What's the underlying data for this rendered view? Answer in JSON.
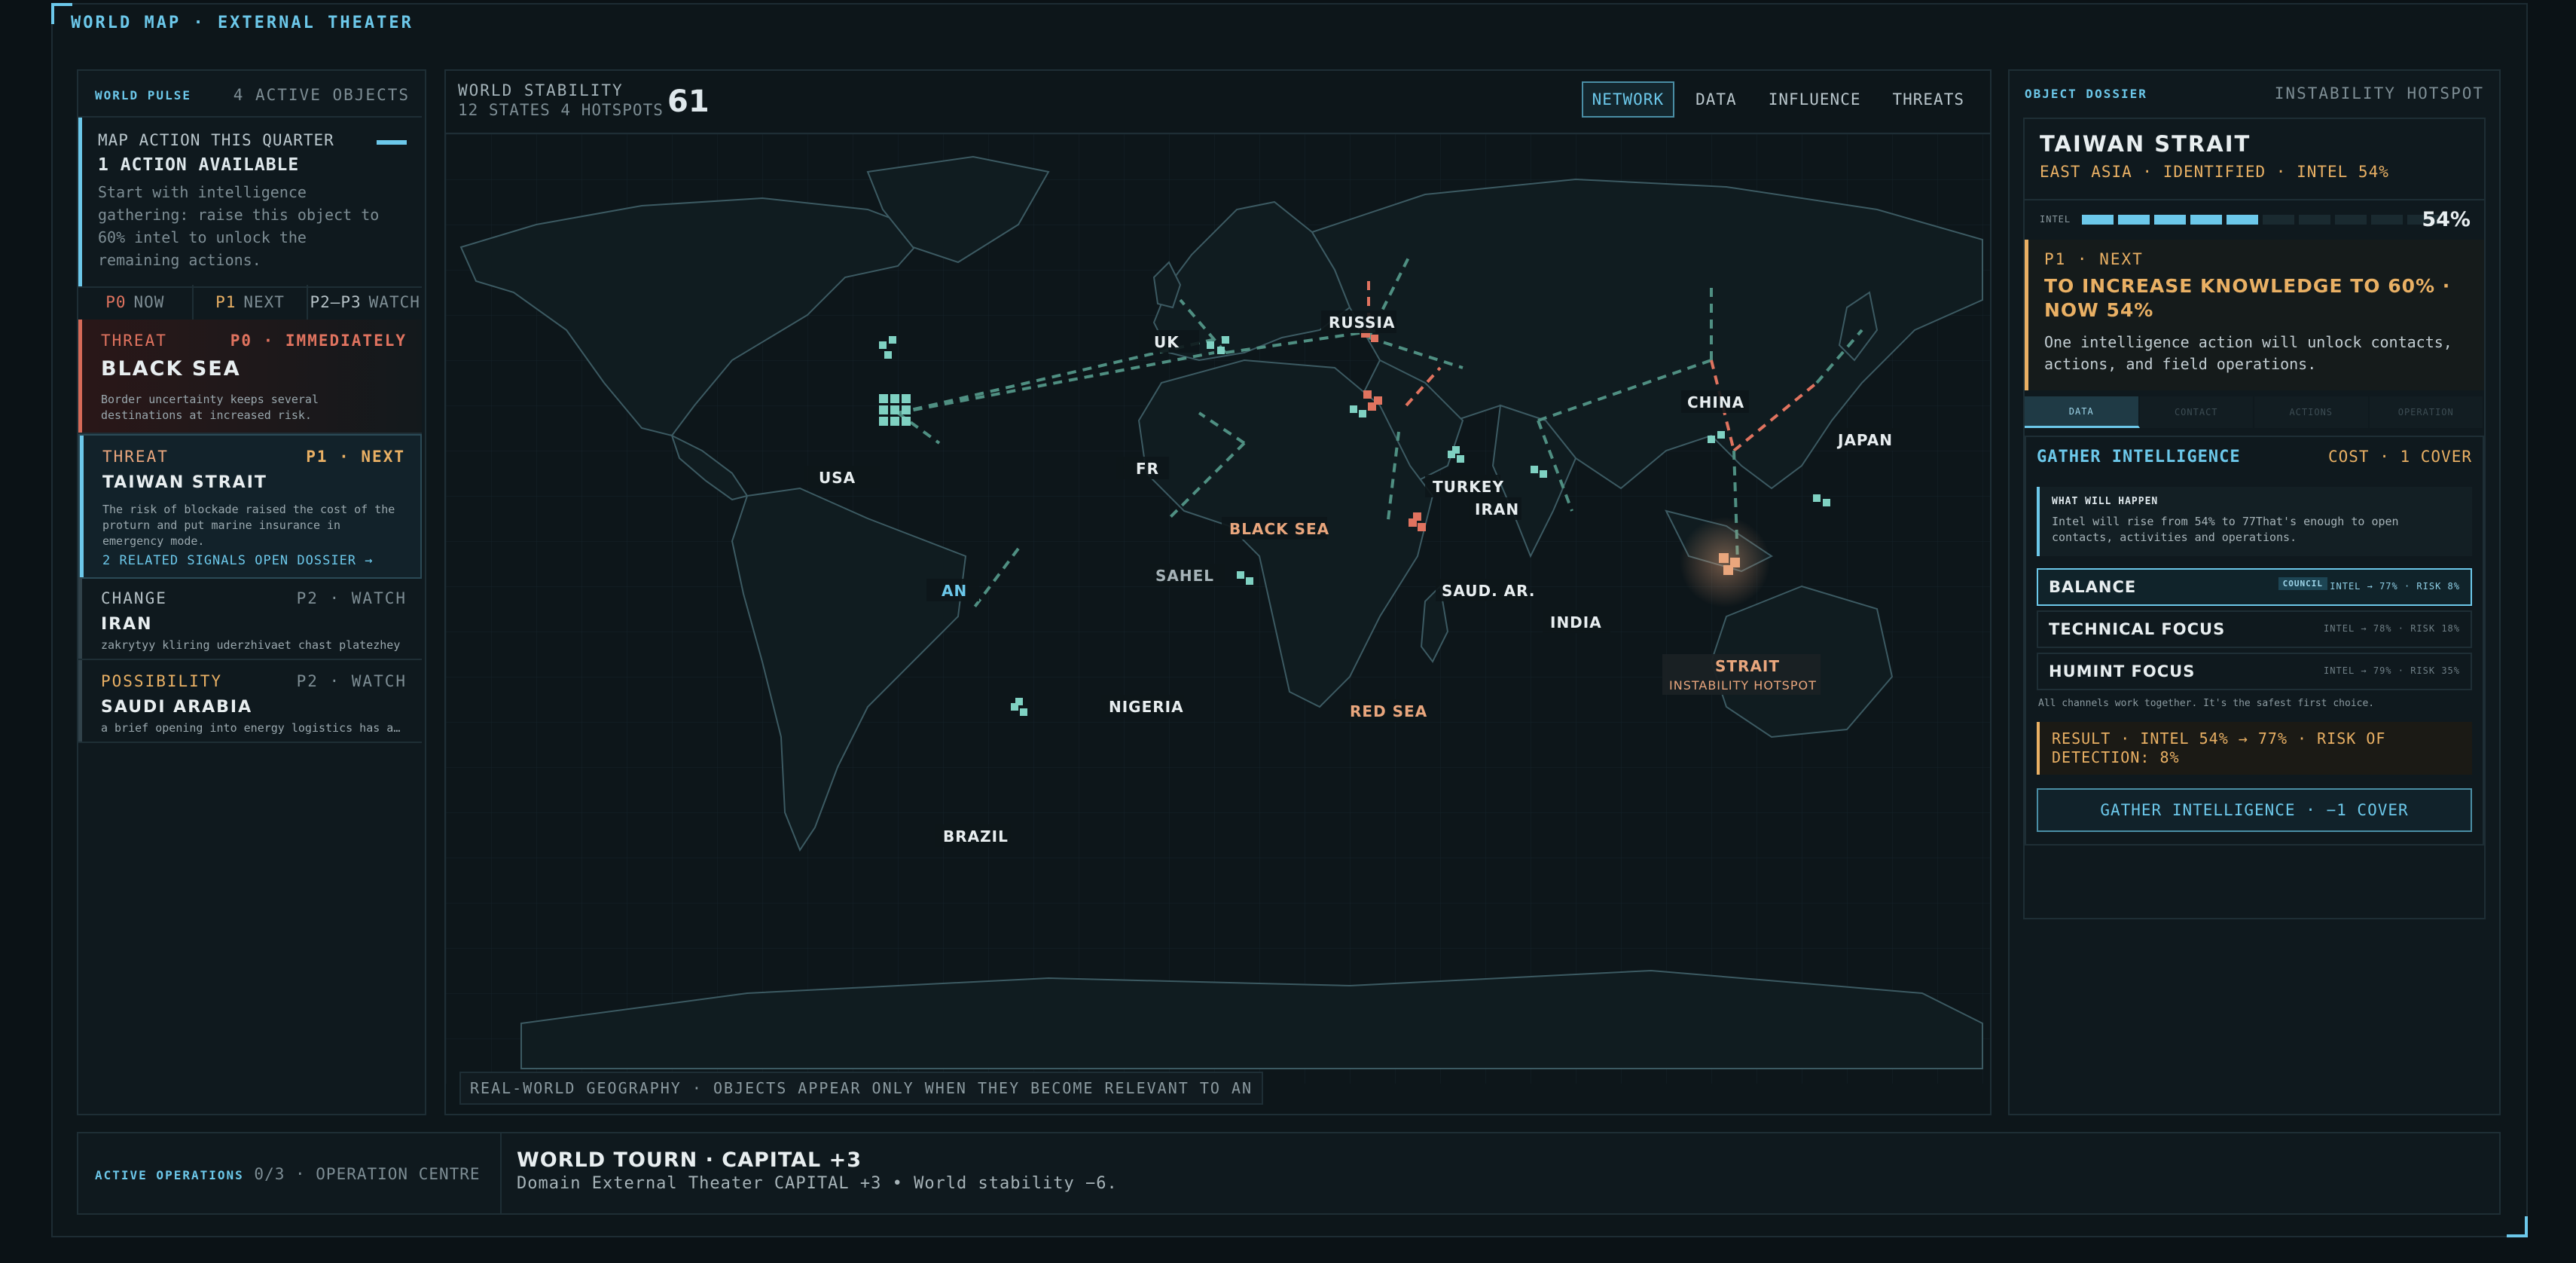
{
  "topbar": {
    "title": "WORLD MAP · EXTERNAL THEATER"
  },
  "left": {
    "title": "WORLD PULSE",
    "count": "4 ACTIVE OBJECTS",
    "map_action": {
      "label": "MAP ACTION THIS QUARTER",
      "headline": "1 ACTION AVAILABLE",
      "text": "Start with intelligence gathering: raise this object to 60% intel to unlock the remaining actions."
    },
    "filters": [
      {
        "key": "P0",
        "label": "NOW"
      },
      {
        "key": "P1",
        "label": "NEXT"
      },
      {
        "key": "P2–P3",
        "label": "WATCH"
      }
    ],
    "cards": [
      {
        "kind": "THREAT",
        "priority": "P0 · IMMEDIATELY",
        "title": "BLACK SEA",
        "text": "Border uncertainty keeps several destinations at increased risk."
      },
      {
        "kind": "THREAT",
        "priority": "P1 · NEXT",
        "title": "TAIWAN STRAIT",
        "text": "The risk of blockade raised the cost of the proturn and put marine insurance in emergency mode.",
        "link": "2 RELATED SIGNALS OPEN DOSSIER →"
      },
      {
        "kind": "CHANGE",
        "priority": "P2 · WATCH",
        "title": "IRAN",
        "text": "zakrytyy kliring uderzhivaet chast platezhey"
      },
      {
        "kind": "POSSIBILITY",
        "priority": "P2 · WATCH",
        "title": "SAUDI ARABIA",
        "text": "a brief opening into energy logistics has appeared"
      }
    ]
  },
  "center": {
    "label": "WORLD STABILITY",
    "sub": "12 STATES 4 HOTSPOTS",
    "value": "61",
    "tabs": [
      "NETWORK",
      "DATA",
      "INFLUENCE",
      "THREATS"
    ],
    "active_tab": "NETWORK",
    "footnote": "REAL-WORLD GEOGRAPHY · OBJECTS APPEAR ONLY WHEN THEY BECOME RELEVANT TO AN",
    "markers": {
      "usa": "USA",
      "an": "AN",
      "uk": "UK",
      "fr": "FR",
      "russia": "RUSSIA",
      "black_sea": "BLACK SEA",
      "turkey": "TURKEY",
      "iran": "IRAN",
      "sahel": "SAHEL",
      "saud_ar": "SAUD. AR.",
      "nigeria": "NIGERIA",
      "red_sea": "RED SEA",
      "brazil": "BRAZIL",
      "india": "INDIA",
      "china": "CHINA",
      "japan": "JAPAN",
      "strait": "STRAIT",
      "strait_sub": "INSTABILITY HOTSPOT"
    }
  },
  "right": {
    "title": "OBJECT DOSSIER",
    "subtitle": "INSTABILITY HOTSPOT",
    "object": "TAIWAN STRAIT",
    "meta": "EAST ASIA · IDENTIFIED · INTEL 54%",
    "intel": {
      "label": "INTEL",
      "value_text": "54%",
      "value": 0.54,
      "segments_total": 10,
      "segments_on": 5
    },
    "next": {
      "tag": "P1 · NEXT",
      "headline": "TO INCREASE KNOWLEDGE TO 60% · NOW 54%",
      "text": "One intelligence action will unlock contacts, actions, and field operations."
    },
    "subtabs": [
      "DATA",
      "CONTACT",
      "ACTIONS",
      "OPERATION"
    ],
    "gather": {
      "title": "GATHER INTELLIGENCE",
      "cost": "COST · 1 COVER",
      "what_label": "WHAT WILL HAPPEN",
      "what_text": "Intel will rise from 54% to 77That's enough to open contacts, activities and operations.",
      "options": [
        {
          "name": "BALANCE",
          "badge": "COUNCIL",
          "meta": "INTEL → 77% · RISK 8%"
        },
        {
          "name": "TECHNICAL FOCUS",
          "meta": "INTEL → 78% · RISK 18%"
        },
        {
          "name": "HUMINT FOCUS",
          "meta": "INTEL → 79% · RISK 35%"
        }
      ],
      "note": "All channels work together. It's the safest first choice.",
      "result": "RESULT · INTEL 54% → 77% · RISK OF DETECTION: 8%",
      "button": "GATHER INTELLIGENCE · −1 COVER"
    }
  },
  "bottom": {
    "label": "ACTIVE OPERATIONS",
    "count": "0/3 · OPERATION CENTRE",
    "title": "WORLD TOURN · CAPITAL +3",
    "text": "Domain External Theater CAPITAL +3 • World stability −6."
  },
  "colors": {
    "accent": "#6cc8ea",
    "threat": "#e0735f",
    "warning": "#e9b064",
    "bg": "#0b1216"
  },
  "icons": [
    "hotspot-cluster-icon",
    "object-cluster-icon"
  ]
}
